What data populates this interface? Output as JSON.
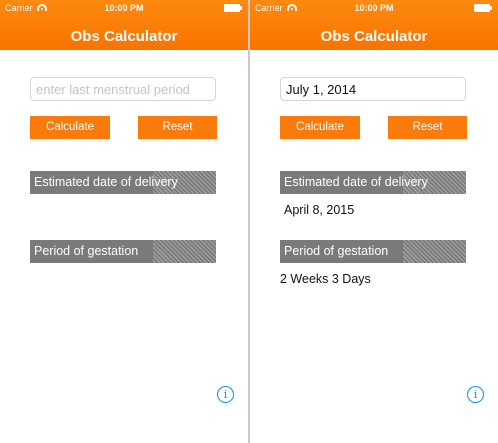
{
  "screens": [
    {
      "status": {
        "carrier": "Carrier",
        "time": "10:00 PM"
      },
      "title": "Obs Calculator",
      "lmp": {
        "value": "",
        "placeholder": "enter last menstrual period"
      },
      "buttons": {
        "calculate": "Calculate",
        "reset": "Reset"
      },
      "edd": {
        "label": "Estimated date of delivery",
        "value": ""
      },
      "gestation": {
        "label": "Period of gestation",
        "value": ""
      },
      "info_glyph": "i"
    },
    {
      "status": {
        "carrier": "Carrier",
        "time": "10:00 PM"
      },
      "title": "Obs Calculator",
      "lmp": {
        "value": "July 1, 2014",
        "placeholder": "enter last menstrual period"
      },
      "buttons": {
        "calculate": "Calculate",
        "reset": "Reset"
      },
      "edd": {
        "label": "Estimated date of delivery",
        "value": "April 8, 2015"
      },
      "gestation": {
        "label": "Period of gestation",
        "value": "2 Weeks 3 Days"
      },
      "info_glyph": "i"
    }
  ],
  "colors": {
    "accent": "#fa7b0c",
    "header": "#f97300",
    "section": "#7a7a7a",
    "info": "#1a8cff"
  },
  "icons": {
    "wifi": "wifi-icon",
    "battery": "battery-icon",
    "info": "info-icon"
  }
}
